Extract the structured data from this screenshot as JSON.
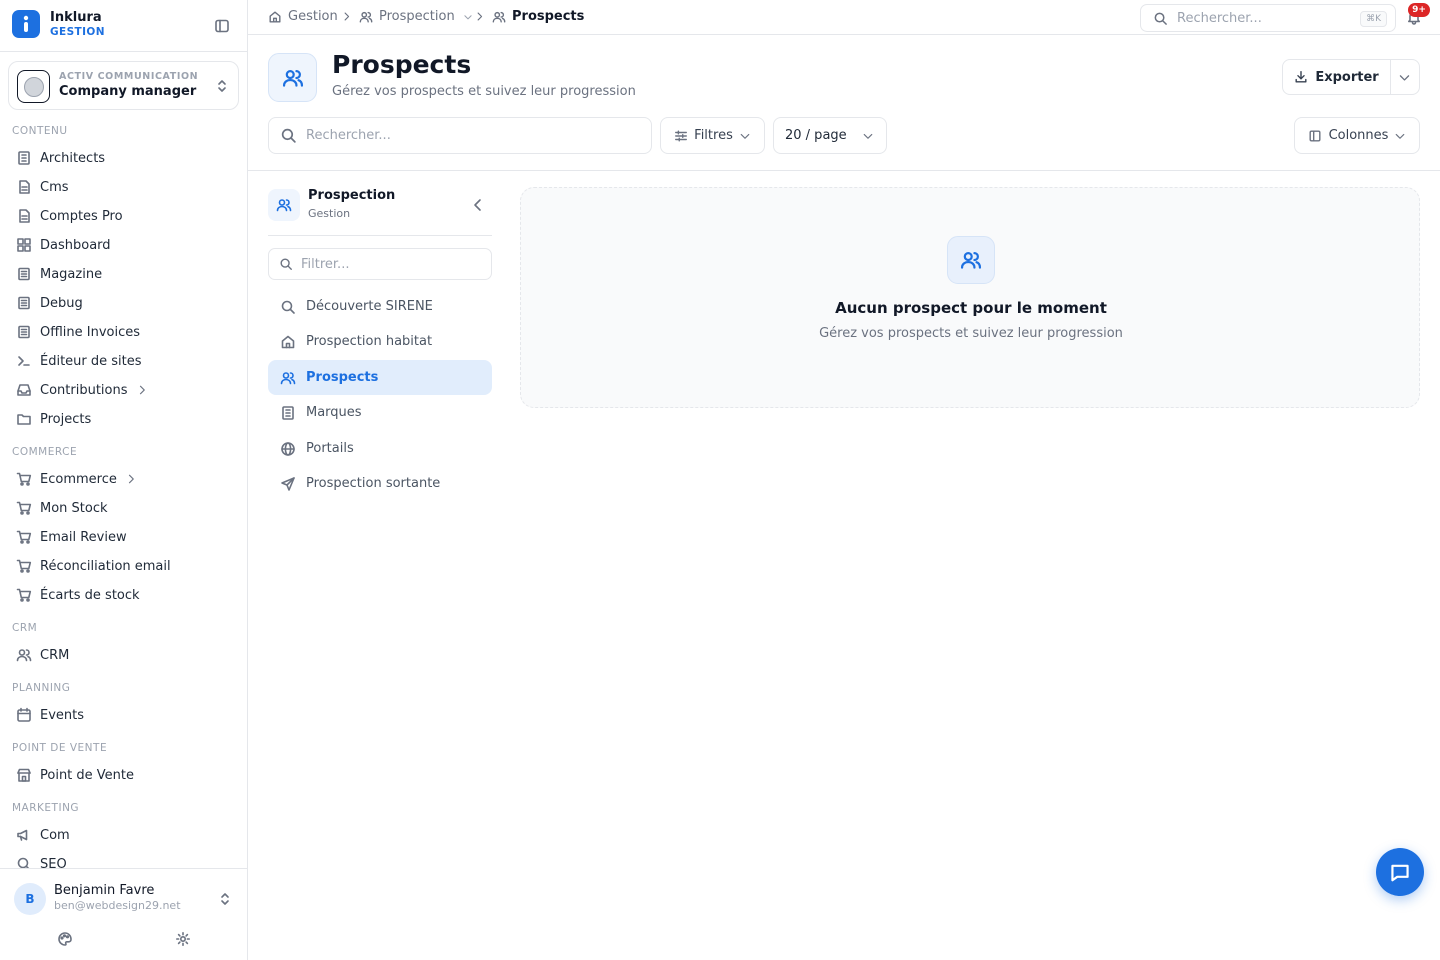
{
  "brand": {
    "name": "Inklura",
    "sub": "GESTION"
  },
  "org": {
    "sub": "ACTIV COMMUNICATION",
    "name": "Company manager"
  },
  "sections": {
    "contenu": "CONTENU",
    "commerce": "COMMERCE",
    "crm": "CRM",
    "planning": "PLANNING",
    "pdv": "POINT DE VENTE",
    "marketing": "MARKETING"
  },
  "nav": {
    "architects": "Architects",
    "cms": "Cms",
    "comptes_pro": "Comptes Pro",
    "dashboard": "Dashboard",
    "magazine": "Magazine",
    "debug": "Debug",
    "offline_invoices": "Offline Invoices",
    "editeur": "Éditeur de sites",
    "contributions": "Contributions",
    "projects": "Projects",
    "ecommerce": "Ecommerce",
    "mon_stock": "Mon Stock",
    "email_review": "Email Review",
    "reconciliation": "Réconciliation email",
    "ecarts": "Écarts de stock",
    "crm": "CRM",
    "events": "Events",
    "point_de_vente": "Point de Vente",
    "com": "Com",
    "seo": "SEO"
  },
  "user": {
    "initial": "B",
    "name": "Benjamin Favre",
    "email": "ben@webdesign29.net"
  },
  "breadcrumb": {
    "gestion": "Gestion",
    "prospection": "Prospection",
    "prospects": "Prospects"
  },
  "top_search": {
    "placeholder": "Rechercher...",
    "shortcut": "⌘K"
  },
  "notifications": {
    "badge": "9+"
  },
  "header": {
    "title": "Prospects",
    "subtitle": "Gérez vos prospects et suivez leur progression",
    "export_label": "Exporter"
  },
  "toolbar": {
    "search_placeholder": "Rechercher...",
    "filters_label": "Filtres",
    "page_size": "20 / page",
    "columns_label": "Colonnes"
  },
  "subnav": {
    "title": "Prospection",
    "subtitle": "Gestion",
    "filter_placeholder": "Filtrer...",
    "items": {
      "decouverte": "Découverte SIRENE",
      "habitat": "Prospection habitat",
      "prospects": "Prospects",
      "marques": "Marques",
      "portails": "Portails",
      "sortante": "Prospection sortante"
    }
  },
  "empty": {
    "title": "Aucun prospect pour le moment",
    "subtitle": "Gérez vos prospects et suivez leur progression"
  },
  "colors": {
    "accent": "#1d70e0",
    "badge": "#dc2626",
    "active_bg": "#e1edfc"
  }
}
